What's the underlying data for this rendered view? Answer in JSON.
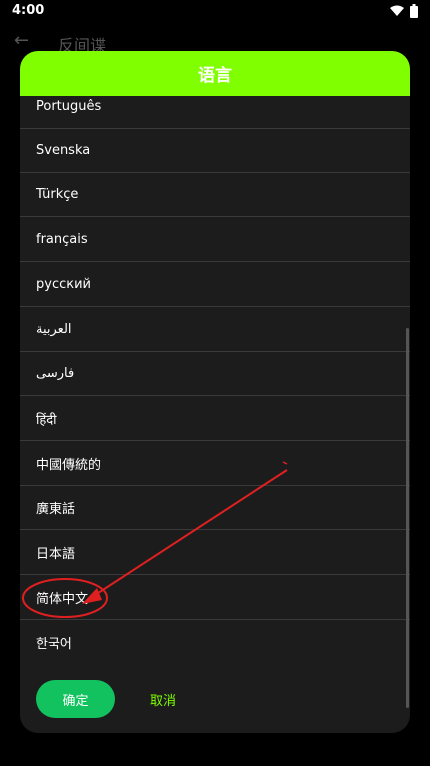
{
  "status_bar": {
    "time": "4:00"
  },
  "background_app": {
    "back_icon": "arrow-left-icon",
    "title": "反间谍"
  },
  "dialog": {
    "title": "语言",
    "languages": [
      "Português",
      "Svenska",
      "Türkçe",
      "français",
      "русский",
      "العربية",
      "فارسی",
      "हिंदी",
      "中國傳統的",
      "廣東話",
      "日本語",
      "简体中文",
      "한국어"
    ],
    "confirm_label": "确定",
    "cancel_label": "取消"
  },
  "colors": {
    "header": "#7fff00",
    "confirm_button": "#12c25e",
    "cancel_text": "#7fff00",
    "annotation": "#e02020"
  }
}
